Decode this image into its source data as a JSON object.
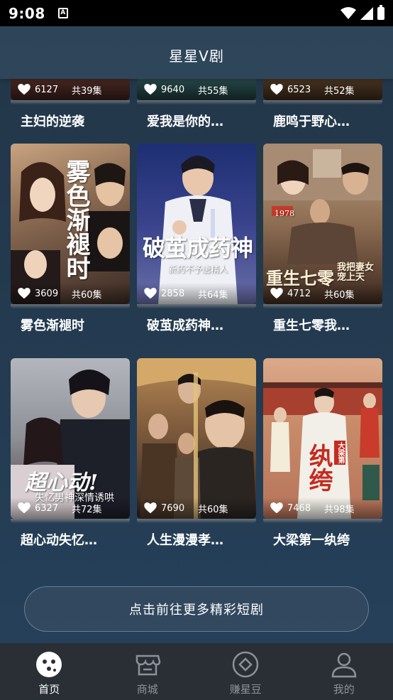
{
  "status_bar": {
    "time": "9:08",
    "app_icon": "A"
  },
  "header": {
    "title": "星星V剧"
  },
  "top_row": [
    {
      "likes": "6127",
      "episodes": "共39集",
      "title": "主妇的逆袭"
    },
    {
      "likes": "9640",
      "episodes": "共55集",
      "title": "爱我是你的…"
    },
    {
      "likes": "6523",
      "episodes": "共52集",
      "title": "鹿鸣于野心…"
    }
  ],
  "row2": [
    {
      "likes": "3609",
      "episodes": "共60集",
      "title": "雾色渐褪时",
      "poster_text": "雾色渐褪时"
    },
    {
      "likes": "2858",
      "episodes": "共64集",
      "title": "破茧成药神…",
      "poster_text": "破茧成药神",
      "poster_sub": "新药不予唐精人"
    },
    {
      "likes": "4712",
      "episodes": "共60集",
      "title": "重生七零我…",
      "poster_text": "重生七零",
      "poster_sub": "我把妻女宠上天",
      "poster_badge": "1978"
    }
  ],
  "row3": [
    {
      "likes": "6327",
      "episodes": "共72集",
      "title": "超心动失忆…",
      "poster_text": "超心动!",
      "poster_sub": "失忆男神深情诱哄"
    },
    {
      "likes": "7690",
      "episodes": "共60集",
      "title": "人生漫漫孝…"
    },
    {
      "likes": "7468",
      "episodes": "共98集",
      "title": "大梁第一纨绔",
      "poster_text": "纨绔",
      "poster_badge": "大梁第"
    }
  ],
  "more_button": {
    "label": "点击前往更多精彩短剧"
  },
  "nav": [
    {
      "label": "首页",
      "icon": "home-icon",
      "active": true
    },
    {
      "label": "商城",
      "icon": "store-icon",
      "active": false
    },
    {
      "label": "赚星豆",
      "icon": "diamond-icon",
      "active": false
    },
    {
      "label": "我的",
      "icon": "profile-icon",
      "active": false
    }
  ],
  "colors": {
    "background": "#23384b",
    "header": "#2f465a",
    "nav_background": "#2a2f36",
    "nav_inactive": "#8d9199",
    "accent": "#ffffff"
  }
}
